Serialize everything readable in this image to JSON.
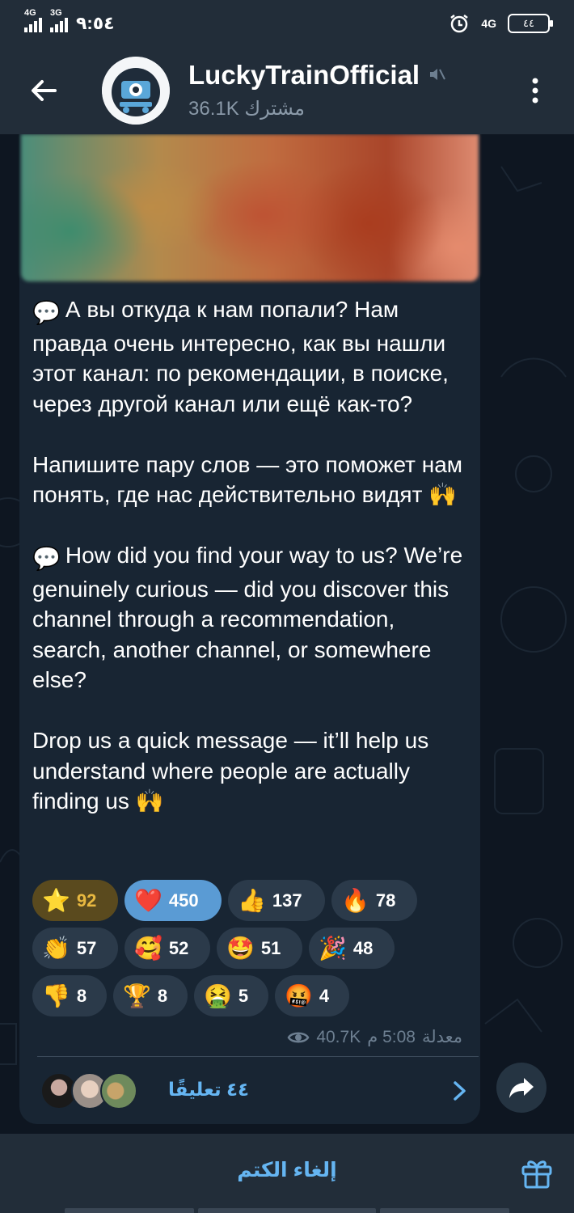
{
  "status_bar": {
    "net1": "4G",
    "net2": "3G",
    "time": "٩:٥٤",
    "right_net": "4G",
    "battery": "٤٤"
  },
  "header": {
    "title": "LuckyTrainOfficial",
    "subscribers": "36.1K مشترك"
  },
  "message": {
    "paragraphs": [
      "А вы откуда к нам попали? Нам правда очень интересно, как вы нашли этот канал: по рекомендации, в поиске, через другой канал или ещё как-то?",
      "Напишите пару слов — это поможет нам понять, где нас действительно видят",
      "How did you find your way to us? We’re genuinely curious — did you discover this channel through a recommendation, search, another channel, or somewhere else?",
      "Drop us a quick message — it’ll help us understand where people are actually finding us"
    ],
    "emoji_speech": "💬",
    "emoji_hands": "🙌",
    "views": "40.7K",
    "time": "5:08 م",
    "edited": "معدلة"
  },
  "reactions": [
    [
      {
        "emoji": "⭐",
        "count": "92"
      },
      {
        "emoji": "❤️",
        "count": "450"
      },
      {
        "emoji": "👍",
        "count": "137"
      },
      {
        "emoji": "🔥",
        "count": "78"
      }
    ],
    [
      {
        "emoji": "👏",
        "count": "57"
      },
      {
        "emoji": "🥰",
        "count": "52"
      },
      {
        "emoji": "🤩",
        "count": "51"
      },
      {
        "emoji": "🎉",
        "count": "48"
      }
    ],
    [
      {
        "emoji": "👎",
        "count": "8"
      },
      {
        "emoji": "🏆",
        "count": "8"
      },
      {
        "emoji": "🤮",
        "count": "5"
      },
      {
        "emoji": "🤬",
        "count": "4"
      }
    ]
  ],
  "comments": {
    "label": "٤٤ تعليقًا"
  },
  "bottom": {
    "unmute": "إلغاء الكتم"
  },
  "colors": {
    "accent": "#65b5f2",
    "bubble": "#182533",
    "header": "#222d39",
    "star_reaction": "#e8b840",
    "selected_reaction": "#5a9bd4"
  },
  "icons": [
    "back-arrow-icon",
    "channel-avatar",
    "muted-icon",
    "more-vert-icon",
    "eye-icon",
    "chevron-right-icon",
    "share-icon",
    "gift-icon"
  ]
}
